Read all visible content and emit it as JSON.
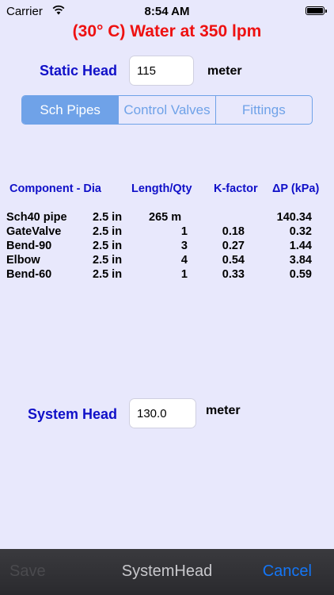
{
  "status_bar": {
    "carrier": "Carrier",
    "time": "8:54 AM"
  },
  "title": "(30° C) Water at 350 lpm",
  "static_head": {
    "label": "Static Head",
    "value": "115",
    "unit": "meter"
  },
  "tabs": [
    {
      "label": "Sch Pipes",
      "selected": true
    },
    {
      "label": "Control Valves",
      "selected": false
    },
    {
      "label": "Fittings",
      "selected": false
    }
  ],
  "table": {
    "headers": [
      "Component - Dia",
      "Length/Qty",
      "K-factor",
      "ΔP (kPa)"
    ],
    "rows": [
      {
        "component": "Sch40 pipe",
        "dia": "2.5 in",
        "length": "265 m",
        "k": "",
        "dp": "140.34"
      },
      {
        "component": "GateValve",
        "dia": "2.5 in",
        "length": "1",
        "k": "0.18",
        "dp": "0.32"
      },
      {
        "component": "Bend-90",
        "dia": "2.5 in",
        "length": "3",
        "k": "0.27",
        "dp": "1.44"
      },
      {
        "component": "Elbow",
        "dia": "2.5 in",
        "length": "4",
        "k": "0.54",
        "dp": "3.84"
      },
      {
        "component": "Bend-60",
        "dia": "2.5 in",
        "length": "1",
        "k": "0.33",
        "dp": "0.59"
      }
    ]
  },
  "system_head": {
    "label": "System Head",
    "value": "130.0",
    "unit": "meter"
  },
  "toolbar": {
    "save": "Save",
    "title": "SystemHead",
    "cancel": "Cancel"
  },
  "colors": {
    "accent": "#6fa2e8",
    "label_blue": "#1010c8",
    "title_red": "#ee1111",
    "cancel_blue": "#1476f6"
  }
}
